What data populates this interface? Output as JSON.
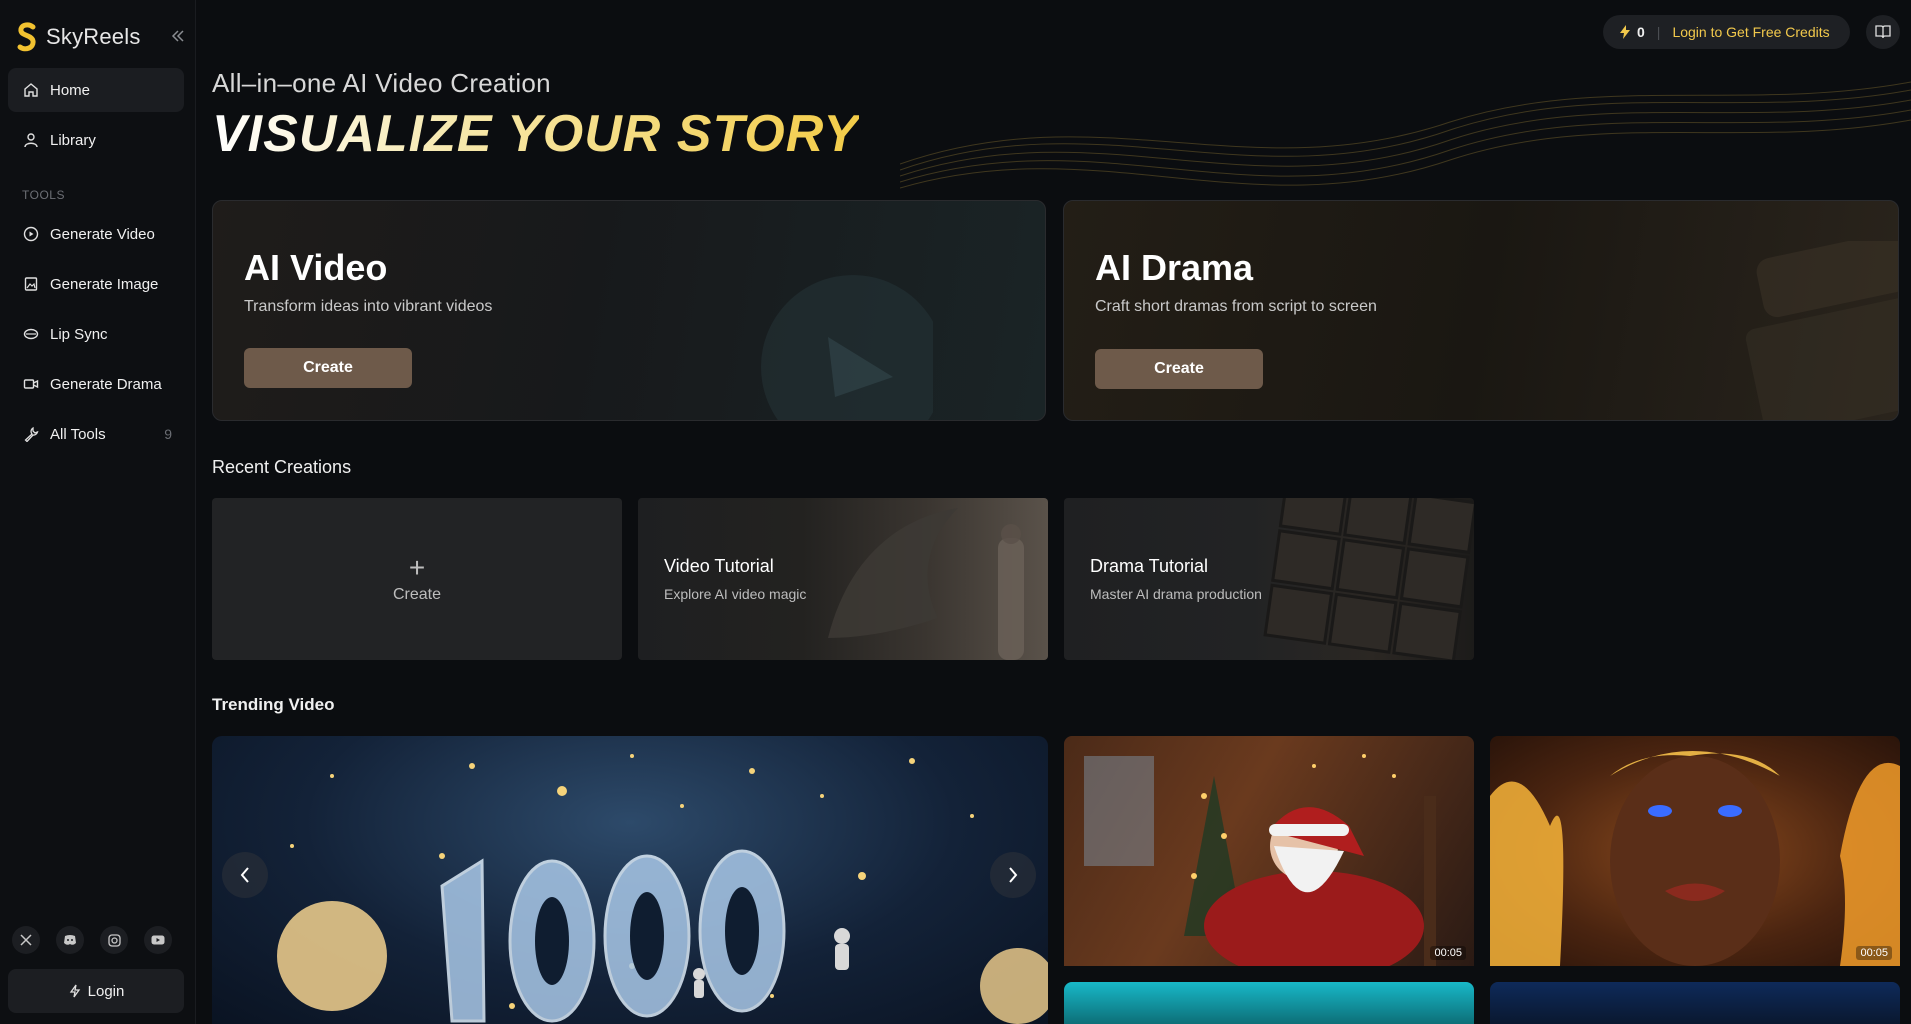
{
  "app": {
    "name": "SkyReels"
  },
  "sidebar": {
    "items": [
      {
        "label": "Home",
        "icon": "home-icon"
      },
      {
        "label": "Library",
        "icon": "user-icon"
      }
    ],
    "section_label": "TOOLS",
    "tools": [
      {
        "label": "Generate Video",
        "icon": "play-circle-icon"
      },
      {
        "label": "Generate Image",
        "icon": "image-icon"
      },
      {
        "label": "Lip Sync",
        "icon": "lips-icon"
      },
      {
        "label": "Generate Drama",
        "icon": "camera-icon"
      },
      {
        "label": "All Tools",
        "icon": "wrench-icon",
        "count": "9"
      }
    ],
    "socials": [
      "x-icon",
      "discord-icon",
      "instagram-icon",
      "youtube-icon"
    ],
    "login_label": "Login"
  },
  "header": {
    "credits": "0",
    "login_link": "Login to Get Free Credits"
  },
  "hero": {
    "subtitle": "All–in–one AI Video Creation",
    "title": "VISUALIZE YOUR STORY"
  },
  "features": [
    {
      "title": "AI Video",
      "desc": "Transform ideas into vibrant videos",
      "button": "Create"
    },
    {
      "title": "AI Drama",
      "desc": "Craft short dramas from script to screen",
      "button": "Create"
    }
  ],
  "recent": {
    "title": "Recent Creations",
    "create_label": "Create",
    "cards": [
      {
        "title": "Video Tutorial",
        "desc": "Explore AI video magic"
      },
      {
        "title": "Drama Tutorial",
        "desc": "Master AI drama production"
      }
    ]
  },
  "trending": {
    "title": "Trending Video",
    "items": [
      {
        "duration": "00:05"
      },
      {
        "duration": "00:05"
      }
    ]
  },
  "colors": {
    "background": "#0b0d10",
    "accent_gold": "#f2c94c",
    "button_brown": "#6e5a4a"
  }
}
